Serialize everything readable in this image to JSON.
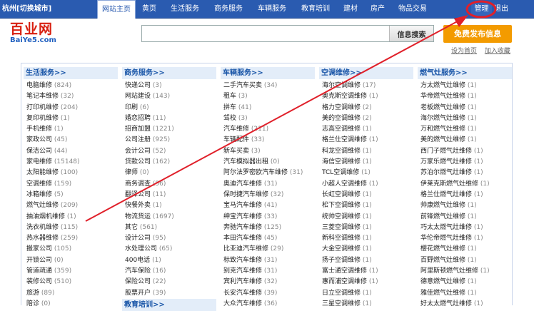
{
  "topbar": {
    "city": "杭州[切换城市]",
    "nav": [
      {
        "label": "网站主页",
        "active": true
      },
      {
        "label": "黄页"
      },
      {
        "label": "生活服务"
      },
      {
        "label": "商务服务"
      },
      {
        "label": "车辆服务"
      },
      {
        "label": "教育培训"
      },
      {
        "label": "建材"
      },
      {
        "label": "房产"
      },
      {
        "label": "物品交易"
      }
    ],
    "admin": "管理",
    "logout": "退出"
  },
  "logo": {
    "cn": "百业网",
    "en": "BaiYe5.com"
  },
  "search": {
    "placeholder": "",
    "button": "信息搜索"
  },
  "post_button": "免费发布信息",
  "sub_links": {
    "home": "设为首页",
    "favorite": "加入收藏"
  },
  "colors": {
    "nav_bg": "#2a5bb0",
    "post_button": "#f39b00",
    "annotation": "#e0202a",
    "section_head": "#1a56a8"
  },
  "columns": [
    {
      "title": "生活服务>>",
      "items": [
        {
          "name": "电脑维修",
          "count": "(824)"
        },
        {
          "name": "笔记本维修",
          "count": "(32)"
        },
        {
          "name": "打印机维修",
          "count": "(204)"
        },
        {
          "name": "复印机维修",
          "count": "(1)"
        },
        {
          "name": "手机维修",
          "count": "(1)"
        },
        {
          "name": "家政公司",
          "count": "(45)"
        },
        {
          "name": "保洁公司",
          "count": "(44)"
        },
        {
          "name": "家电维修",
          "count": "(15148)"
        },
        {
          "name": "太阳能维修",
          "count": "(100)"
        },
        {
          "name": "空调维修",
          "count": "(159)"
        },
        {
          "name": "冰箱维修",
          "count": "(5)"
        },
        {
          "name": "燃气灶维修",
          "count": "(209)"
        },
        {
          "name": "抽油烟机维修",
          "count": "(1)"
        },
        {
          "name": "洗衣机维修",
          "count": "(115)"
        },
        {
          "name": "热水器维修",
          "count": "(259)"
        },
        {
          "name": "搬家公司",
          "count": "(105)"
        },
        {
          "name": "开锁公司",
          "count": "(0)"
        },
        {
          "name": "管道疏通",
          "count": "(359)"
        },
        {
          "name": "装修公司",
          "count": "(510)"
        },
        {
          "name": "旅游",
          "count": "(89)"
        },
        {
          "name": "陪诊",
          "count": "(0)"
        }
      ]
    },
    {
      "title": "商务服务>>",
      "items": [
        {
          "name": "快递公司",
          "count": "(3)"
        },
        {
          "name": "网站建设",
          "count": "(143)"
        },
        {
          "name": "印刷",
          "count": "(6)"
        },
        {
          "name": "婚恋招聘",
          "count": "(11)"
        },
        {
          "name": "招商加盟",
          "count": "(1221)"
        },
        {
          "name": "公司注册",
          "count": "(925)"
        },
        {
          "name": "会计公司",
          "count": "(52)"
        },
        {
          "name": "贷款公司",
          "count": "(162)"
        },
        {
          "name": "律师",
          "count": "(0)"
        },
        {
          "name": "商务调查",
          "count": "(56)"
        },
        {
          "name": "翻译公司",
          "count": "(11)"
        },
        {
          "name": "快餐外卖",
          "count": "(1)"
        },
        {
          "name": "物流货运",
          "count": "(1697)"
        },
        {
          "name": "其它",
          "count": "(561)"
        },
        {
          "name": "设计公司",
          "count": "(95)"
        },
        {
          "name": "水处理公司",
          "count": "(65)"
        },
        {
          "name": "400电话",
          "count": "(1)"
        },
        {
          "name": "汽车保险",
          "count": "(16)"
        },
        {
          "name": "保险公司",
          "count": "(22)"
        },
        {
          "name": "股票开户",
          "count": "(39)"
        }
      ],
      "sub_title": "教育培训>>"
    },
    {
      "title": "车辆服务>>",
      "items": [
        {
          "name": "二手汽车买卖",
          "count": "(34)"
        },
        {
          "name": "租车",
          "count": "(3)"
        },
        {
          "name": "拼车",
          "count": "(41)"
        },
        {
          "name": "驾校",
          "count": "(3)"
        },
        {
          "name": "汽车维修",
          "count": "(211)"
        },
        {
          "name": "车辆配件",
          "count": "(33)"
        },
        {
          "name": "新车买卖",
          "count": "(3)"
        },
        {
          "name": "汽车模拟器出租",
          "count": "(0)"
        },
        {
          "name": "阿尔法罗密欧汽车维修",
          "count": "(31)"
        },
        {
          "name": "奥迪汽车维修",
          "count": "(31)"
        },
        {
          "name": "保时捷汽车维修",
          "count": "(32)"
        },
        {
          "name": "宝马汽车维修",
          "count": "(41)"
        },
        {
          "name": "绅宝汽车维修",
          "count": "(33)"
        },
        {
          "name": "奔驰汽车维修",
          "count": "(125)"
        },
        {
          "name": "本田汽车维修",
          "count": "(45)"
        },
        {
          "name": "比亚迪汽车维修",
          "count": "(29)"
        },
        {
          "name": "标致汽车维修",
          "count": "(31)"
        },
        {
          "name": "别克汽车维修",
          "count": "(31)"
        },
        {
          "name": "宾利汽车维修",
          "count": "(32)"
        },
        {
          "name": "长安汽车维修",
          "count": "(39)"
        },
        {
          "name": "大众汽车维修",
          "count": "(36)"
        }
      ]
    },
    {
      "title": "空调维修>>",
      "items": [
        {
          "name": "海尔空调维修",
          "count": "(17)"
        },
        {
          "name": "奥克斯空调维修",
          "count": "(1)"
        },
        {
          "name": "格力空调维修",
          "count": "(2)"
        },
        {
          "name": "美的空调维修",
          "count": "(2)"
        },
        {
          "name": "志高空调维修",
          "count": "(1)"
        },
        {
          "name": "格兰仕空调维修",
          "count": "(1)"
        },
        {
          "name": "科龙空调维修",
          "count": "(1)"
        },
        {
          "name": "海信空调维修",
          "count": "(1)"
        },
        {
          "name": "TCL空调维修",
          "count": "(1)"
        },
        {
          "name": "小超人空调维修",
          "count": "(1)"
        },
        {
          "name": "长虹空调维修",
          "count": "(1)"
        },
        {
          "name": "松下空调维修",
          "count": "(1)"
        },
        {
          "name": "统帅空调维修",
          "count": "(1)"
        },
        {
          "name": "三菱空调维修",
          "count": "(1)"
        },
        {
          "name": "新科空调维修",
          "count": "(1)"
        },
        {
          "name": "大金空调维修",
          "count": "(1)"
        },
        {
          "name": "扬子空调维修",
          "count": "(1)"
        },
        {
          "name": "富士通空调维修",
          "count": "(1)"
        },
        {
          "name": "惠而浦空调维修",
          "count": "(1)"
        },
        {
          "name": "日立空调维修",
          "count": "(1)"
        },
        {
          "name": "三星空调维修",
          "count": "(1)"
        }
      ]
    },
    {
      "title": "燃气灶服务>>",
      "items": [
        {
          "name": "方太燃气灶维修",
          "count": "(1)"
        },
        {
          "name": "华帝燃气灶维修",
          "count": "(1)"
        },
        {
          "name": "老板燃气灶维修",
          "count": "(1)"
        },
        {
          "name": "海尔燃气灶维修",
          "count": "(1)"
        },
        {
          "name": "万和燃气灶维修",
          "count": "(1)"
        },
        {
          "name": "美的燃气灶维修",
          "count": "(1)"
        },
        {
          "name": "西门子燃气灶维修",
          "count": "(1)"
        },
        {
          "name": "万家乐燃气灶维修",
          "count": "(1)"
        },
        {
          "name": "苏泊尔燃气灶维修",
          "count": "(1)"
        },
        {
          "name": "伊莱克斯燃气灶维修",
          "count": "(1)"
        },
        {
          "name": "格兰仕燃气灶维修",
          "count": "(1)"
        },
        {
          "name": "帅康燃气灶维修",
          "count": "(1)"
        },
        {
          "name": "前锋燃气灶维修",
          "count": "(1)"
        },
        {
          "name": "巧太太燃气灶维修",
          "count": "(1)"
        },
        {
          "name": "华伦帝燃气灶维修",
          "count": "(1)"
        },
        {
          "name": "樱花燃气灶维修",
          "count": "(1)"
        },
        {
          "name": "百野燃气灶维修",
          "count": "(1)"
        },
        {
          "name": "阿里斯顿燃气灶维修",
          "count": "(1)"
        },
        {
          "name": "德意燃气灶维修",
          "count": "(1)"
        },
        {
          "name": "雅佳燃气灶维修",
          "count": "(1)"
        },
        {
          "name": "好太太燃气灶维修",
          "count": "(1)"
        }
      ]
    }
  ]
}
